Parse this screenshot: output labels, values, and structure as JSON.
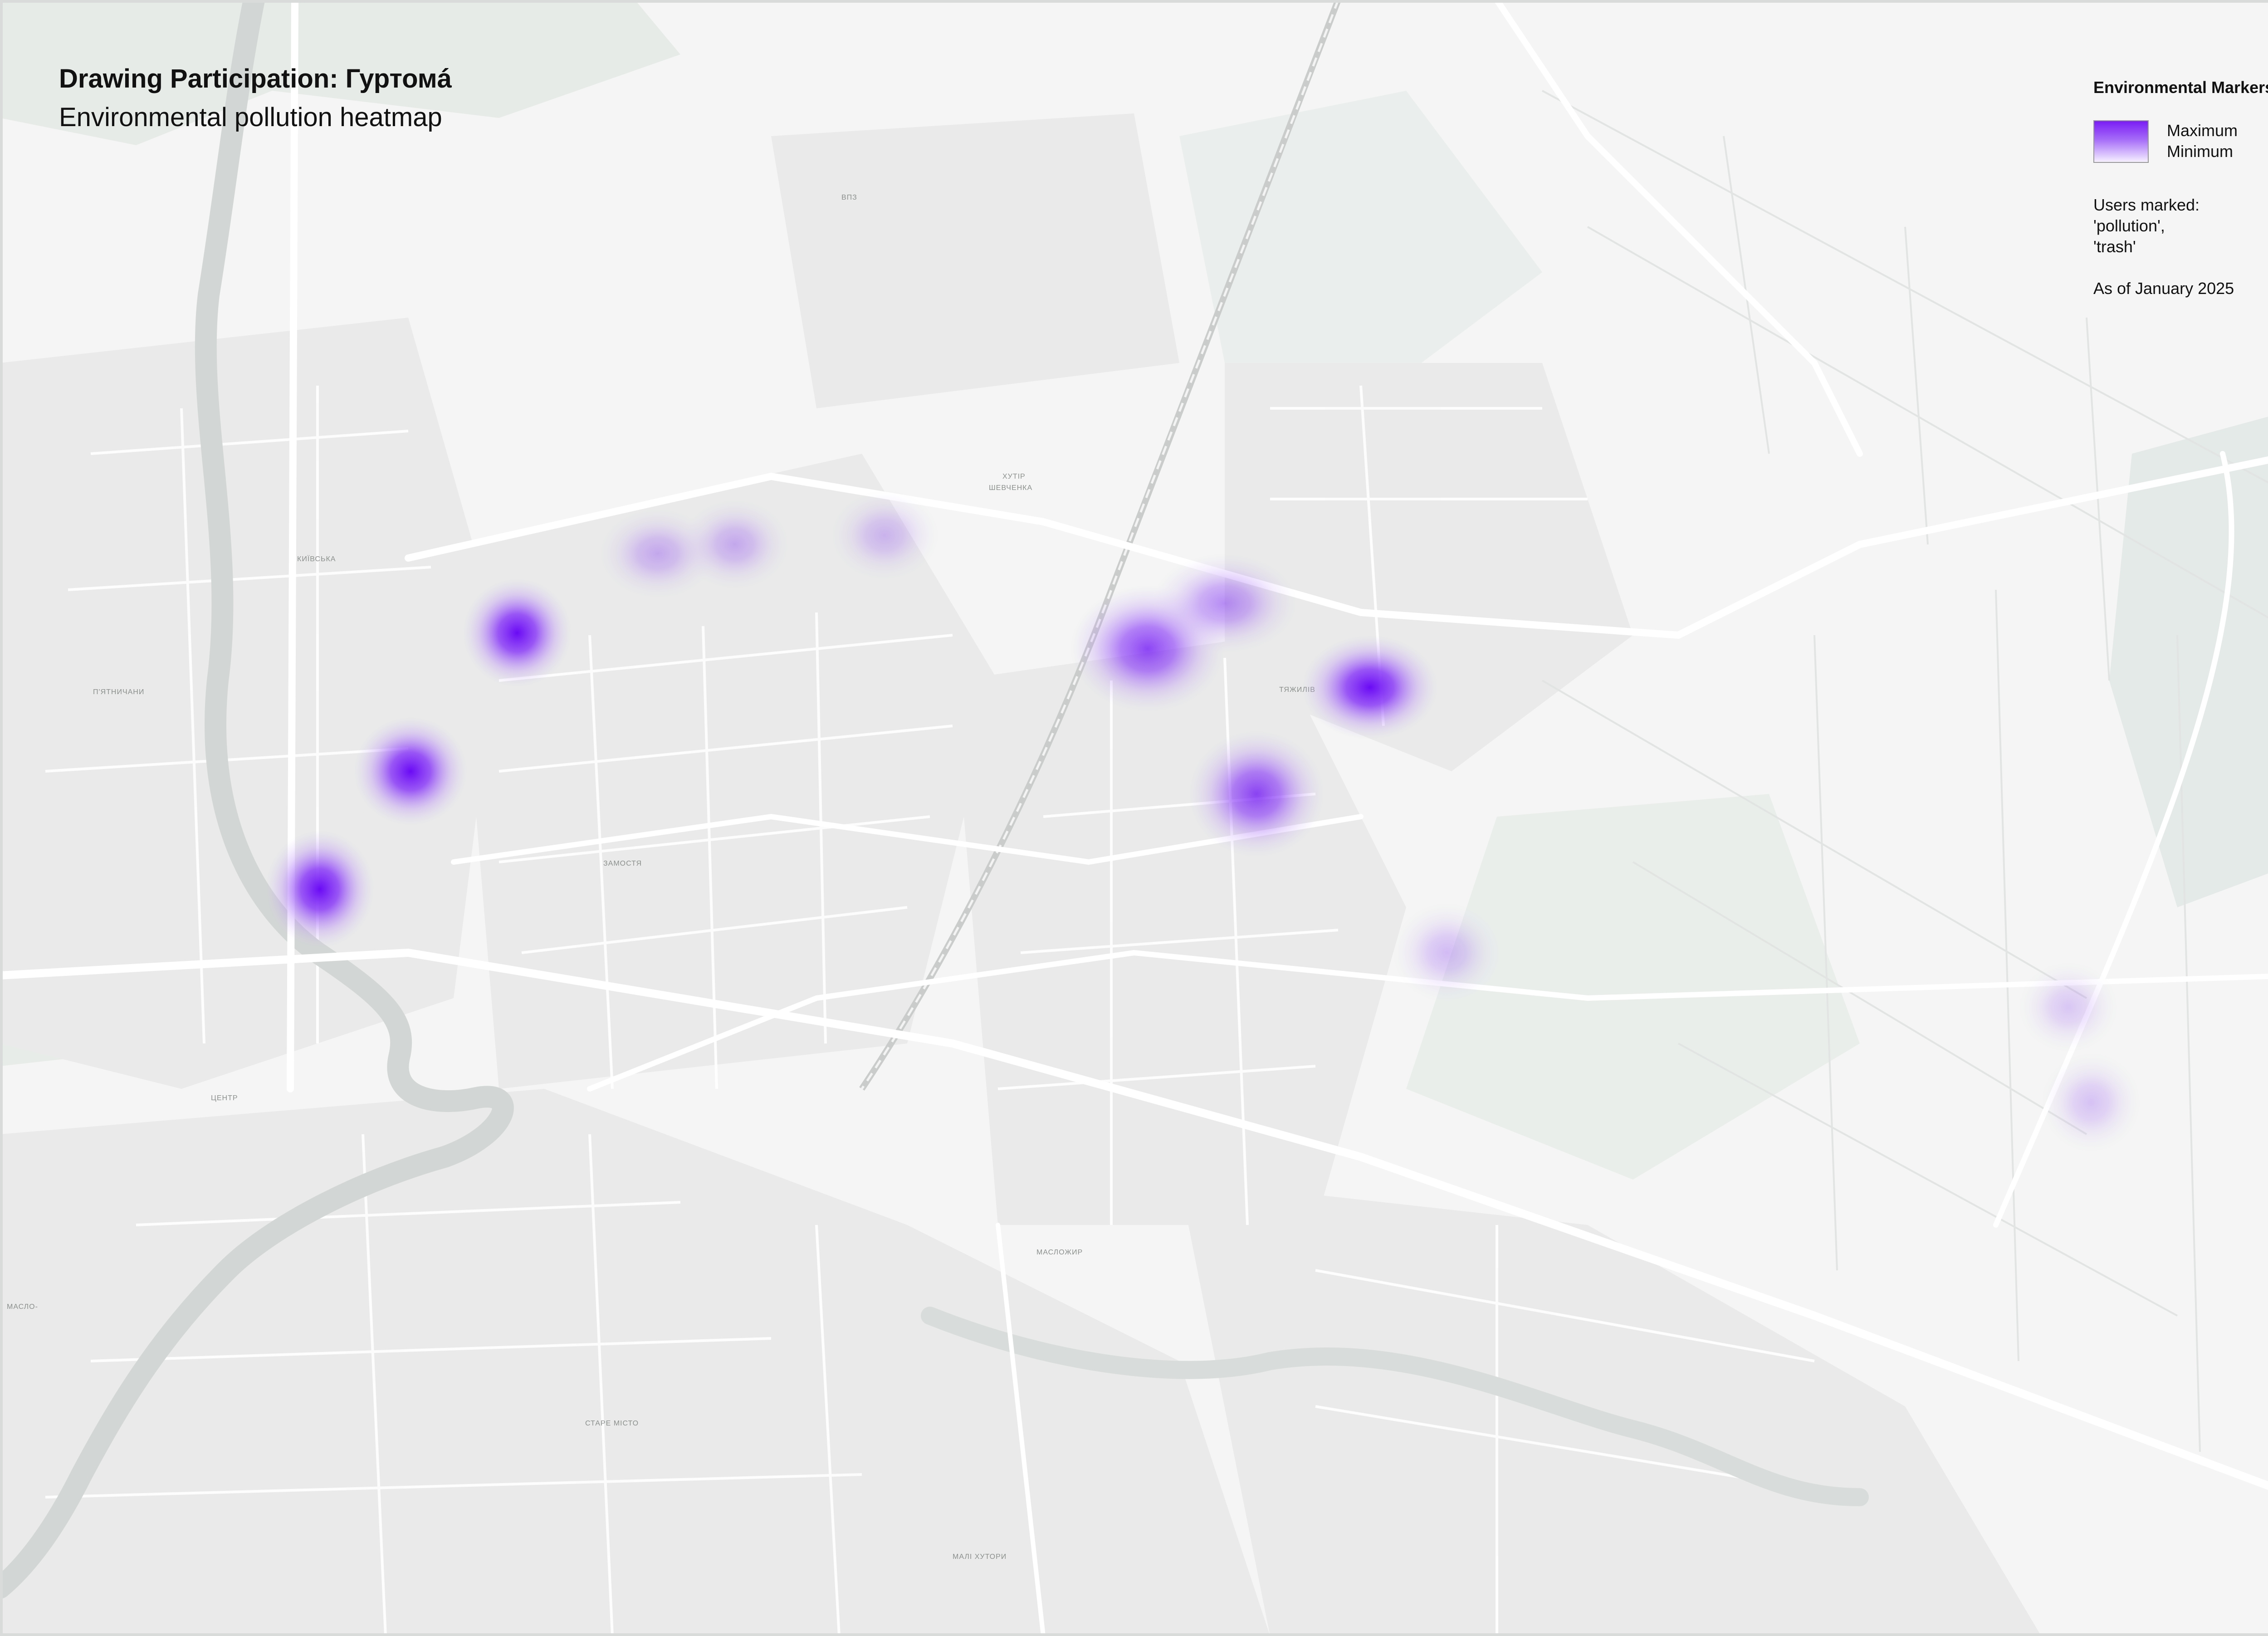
{
  "title": "Drawing Participation: Гуртомá",
  "subtitle": "Environmental pollution heatmap",
  "legend": {
    "title": "Environmental Markers",
    "max_label": "Maximum",
    "min_label": "Minimum",
    "note_line1": "Users marked:",
    "note_line2": "'pollution',",
    "note_line3": "'trash'",
    "date": "As of January 2025",
    "max_color": "#7a1cf5",
    "min_color": "#f6f0ff"
  },
  "districts": [
    {
      "id": "kyivska",
      "label": "КИЇВСЬКА"
    },
    {
      "id": "piatnychany",
      "label": "П'ЯТНИЧАНИ"
    },
    {
      "id": "zamostia",
      "label": "ЗАМОСТЯ"
    },
    {
      "id": "khutir",
      "label": "ХУТІР"
    },
    {
      "id": "shevchenka",
      "label": "ШЕВЧЕНКА"
    },
    {
      "id": "tiazhyliv",
      "label": "ТЯЖИЛІВ"
    },
    {
      "id": "tsentr",
      "label": "ЦЕНТР"
    },
    {
      "id": "maslozhyr",
      "label": "МАСЛОЖИР"
    },
    {
      "id": "stare-misto",
      "label": "СТАРЕ МІСТО"
    },
    {
      "id": "mali-khutory",
      "label": "МАЛІ ХУТОРИ"
    },
    {
      "id": "masliv",
      "label": "МАСЛО-"
    },
    {
      "id": "vzr",
      "label": "ВПЗ"
    }
  ],
  "hotspots": [
    {
      "id": "h1",
      "intensity": 0.95
    },
    {
      "id": "h2",
      "intensity": 0.8
    },
    {
      "id": "h3",
      "intensity": 0.7
    },
    {
      "id": "h4",
      "intensity": 0.7
    },
    {
      "id": "h5",
      "intensity": 0.55
    },
    {
      "id": "h6",
      "intensity": 0.55
    },
    {
      "id": "h7",
      "intensity": 0.25
    },
    {
      "id": "h8",
      "intensity": 0.25
    },
    {
      "id": "h9",
      "intensity": 0.2
    },
    {
      "id": "h10",
      "intensity": 0.2
    },
    {
      "id": "h11",
      "intensity": 0.2
    },
    {
      "id": "h12",
      "intensity": 0.15
    }
  ]
}
